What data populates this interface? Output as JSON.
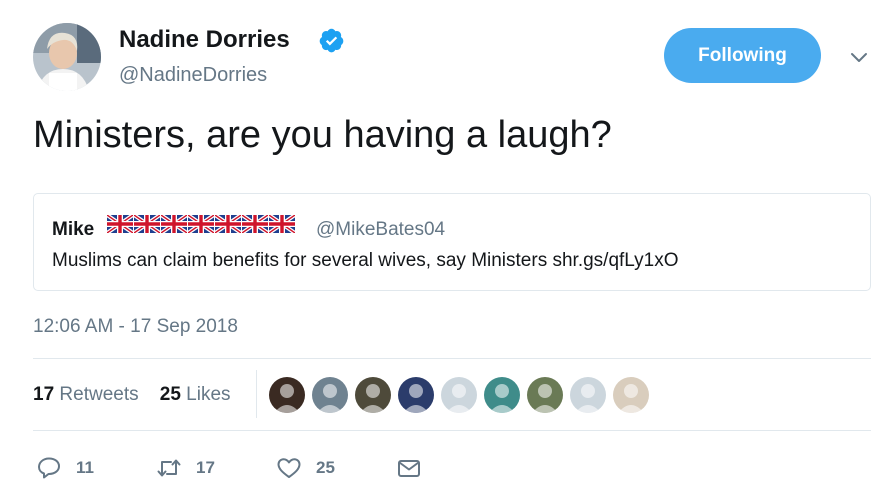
{
  "tweet": {
    "author_name": "Nadine Dorries",
    "author_handle": "@NadineDorries",
    "follow_label": "Following",
    "text": "Ministers, are you having a laugh?",
    "timestamp": "12:06 AM - 17 Sep 2018",
    "verified_icon": "verified-badge-icon",
    "menu_icon": "chevron-down-icon"
  },
  "quote": {
    "name": "Mike",
    "flags": [
      "uk-flag-icon",
      "uk-flag-icon",
      "uk-flag-icon",
      "uk-flag-icon",
      "uk-flag-icon",
      "uk-flag-icon",
      "uk-flag-icon"
    ],
    "handle": "@MikeBates04",
    "text": "Muslims can claim benefits for several wives, say Ministers shr.gs/qfLy1xO"
  },
  "stats": {
    "retweets_count": "17",
    "retweets_label": "Retweets",
    "likes_count": "25",
    "likes_label": "Likes"
  },
  "likers": [
    {
      "name": "liker-avatar-1",
      "color": "#3a2a22"
    },
    {
      "name": "liker-avatar-2",
      "color": "#6f8290"
    },
    {
      "name": "liker-avatar-3",
      "color": "#4e4a3a"
    },
    {
      "name": "liker-avatar-4",
      "color": "#2b3c6b"
    },
    {
      "name": "liker-avatar-5",
      "color": "#ccd6dd"
    },
    {
      "name": "liker-avatar-6",
      "color": "#3f8c8a"
    },
    {
      "name": "liker-avatar-7",
      "color": "#6a7a55"
    },
    {
      "name": "liker-avatar-8",
      "color": "#ccd6dd"
    },
    {
      "name": "liker-avatar-9",
      "color": "#d9cdbd"
    }
  ],
  "actions": {
    "reply_count": "11",
    "retweet_count": "17",
    "like_count": "25"
  },
  "colors": {
    "accent": "#4aabef",
    "secondary_text": "#657786",
    "divider": "#e1e8ed"
  }
}
